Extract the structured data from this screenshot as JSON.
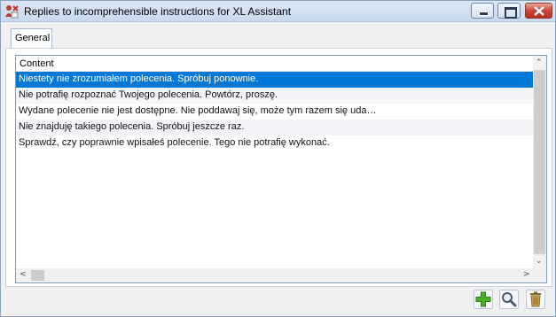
{
  "window": {
    "title": "Replies to incomprehensible instructions for XL Assistant",
    "icons": [
      "app-icon",
      "minimize-icon",
      "maximize-icon",
      "close-icon"
    ]
  },
  "tabs": [
    {
      "label": "General",
      "active": true
    }
  ],
  "list": {
    "column_header": "Content",
    "rows": [
      {
        "text": "Niestety nie zrozumiałem polecenia. Spróbuj ponownie.",
        "selected": true
      },
      {
        "text": "Nie potrafię rozpoznać Twojego polecenia. Powtórz, proszę.",
        "selected": false
      },
      {
        "text": "Wydane polecenie nie jest dostępne. Nie poddawaj się, może tym razem się uda…",
        "selected": false
      },
      {
        "text": "Nie znajduję takiego polecenia. Spróbuj jeszcze raz.",
        "selected": false
      },
      {
        "text": "Sprawdź, czy poprawnie wpisałeś polecenie. Tego nie potrafię wykonać.",
        "selected": false
      }
    ],
    "scroll_icons": [
      "scroll-up-icon",
      "scroll-down-icon",
      "scroll-left-icon",
      "scroll-right-icon"
    ]
  },
  "actions": [
    {
      "name": "add",
      "icon": "plus-icon"
    },
    {
      "name": "view",
      "icon": "magnifier-icon"
    },
    {
      "name": "delete",
      "icon": "trash-icon"
    }
  ],
  "colors": {
    "selection": "#0078d7",
    "titlebar": "#c9d9ee",
    "close_button": "#c9463a",
    "add_icon": "#4caf2a"
  }
}
